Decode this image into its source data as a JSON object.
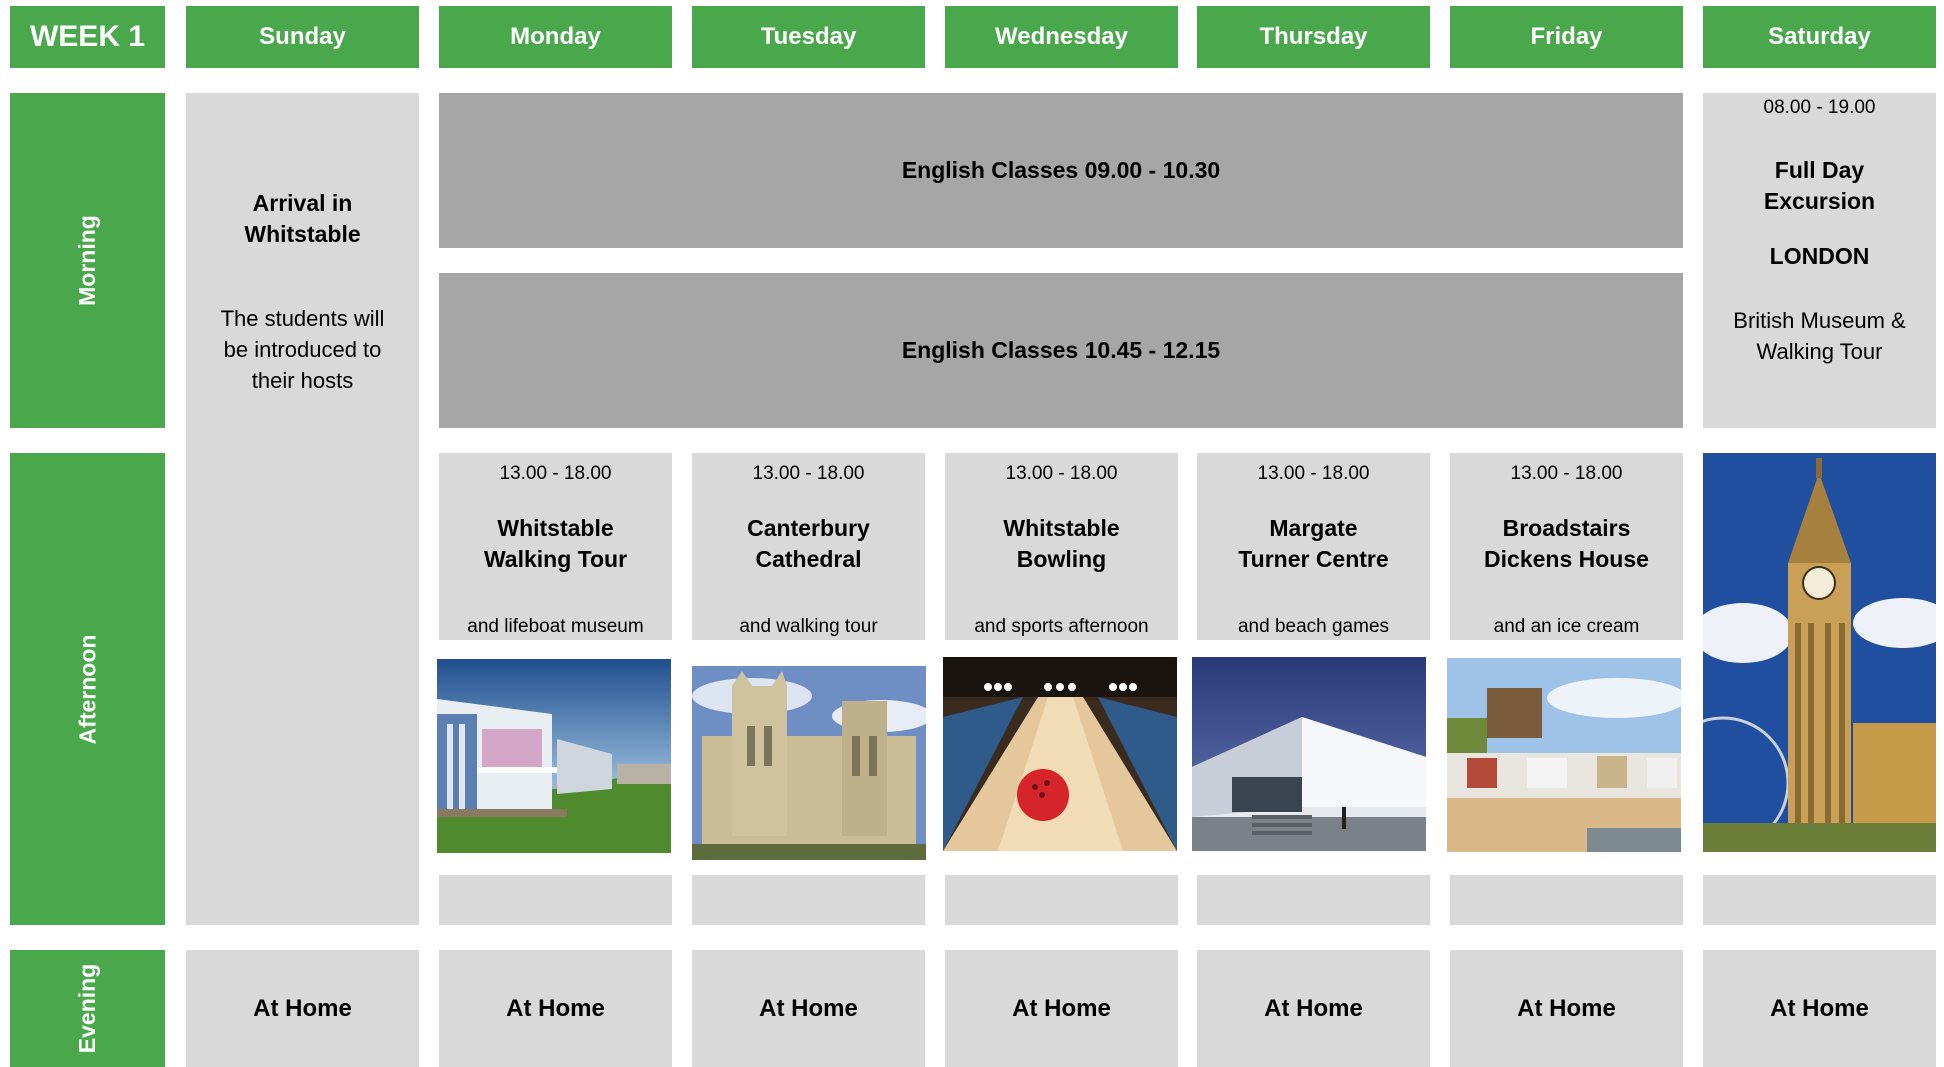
{
  "week_label": "WEEK 1",
  "days": [
    "Sunday",
    "Monday",
    "Tuesday",
    "Wednesday",
    "Thursday",
    "Friday",
    "Saturday"
  ],
  "periods": {
    "morning": "Morning",
    "afternoon": "Afternoon",
    "evening": "Evening"
  },
  "sunday": {
    "arrival_title": "Arrival in Whitstable",
    "arrival_text": "The students will be introduced to their hosts"
  },
  "classes": [
    {
      "label": "English Classes 09.00 - 10.30"
    },
    {
      "label": "English Classes 10.45 - 12.15"
    }
  ],
  "saturday": {
    "time": "08.00 - 19.00",
    "title": "Full Day Excursion",
    "city": "LONDON",
    "details": "British Museum & Walking Tour",
    "photo_icon": "big-ben-photo"
  },
  "afternoons": [
    {
      "day": "Monday",
      "time": "13.00 - 18.00",
      "title": "Whitstable Walking Tour",
      "sub": "and lifeboat museum",
      "photo_icon": "beach-huts-photo"
    },
    {
      "day": "Tuesday",
      "time": "13.00 - 18.00",
      "title": "Canterbury Cathedral",
      "sub": "and walking tour",
      "photo_icon": "cathedral-photo"
    },
    {
      "day": "Wednesday",
      "time": "13.00 - 18.00",
      "title": "Whitstable Bowling",
      "sub": "and sports afternoon",
      "photo_icon": "bowling-photo"
    },
    {
      "day": "Thursday",
      "time": "13.00 - 18.00",
      "title": "Margate Turner Centre",
      "sub": "and beach games",
      "photo_icon": "gallery-photo"
    },
    {
      "day": "Friday",
      "time": "13.00 - 18.00",
      "title": "Broadstairs Dickens House",
      "sub": "and an ice cream",
      "photo_icon": "seaside-town-photo"
    }
  ],
  "evening": [
    "At Home",
    "At Home",
    "At Home",
    "At Home",
    "At Home",
    "At Home",
    "At Home"
  ],
  "colors": {
    "green": "#4aa84c",
    "light_grey": "#d9d9d9",
    "dark_grey": "#a6a6a6"
  }
}
